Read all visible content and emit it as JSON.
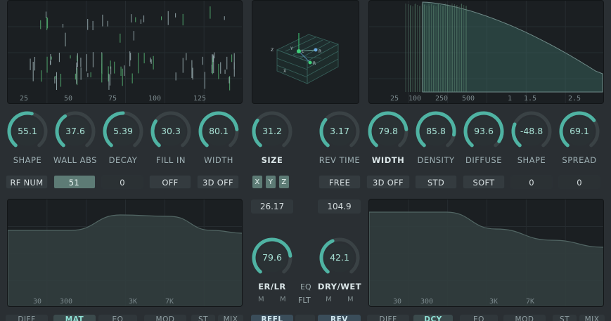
{
  "colors": {
    "accent": "#4fb3a3",
    "background": "#2a2f33",
    "panel": "#1b1f22",
    "value_text": "#a7e0d4"
  },
  "left_scope": {
    "ticks": [
      "25",
      "50",
      "75",
      "100",
      "125"
    ]
  },
  "room_view": {
    "axis_labels": [
      "Z",
      "Y",
      "L",
      "R",
      "X",
      "R"
    ]
  },
  "right_scope": {
    "ticks": [
      "25",
      "100",
      "250",
      "500",
      "1",
      "1.5",
      "2.5"
    ]
  },
  "left_knobs": [
    {
      "label": "SHAPE",
      "value": "55.1",
      "level": 0.55
    },
    {
      "label": "WALL ABS",
      "value": "37.6",
      "level": 0.38
    },
    {
      "label": "DECAY",
      "value": "5.39",
      "level": 0.5
    },
    {
      "label": "FILL IN",
      "value": "30.3",
      "level": 0.3
    },
    {
      "label": "WIDTH",
      "value": "80.1",
      "level": 0.8
    }
  ],
  "size_knob": {
    "label": "SIZE",
    "value": "31.2",
    "level": 0.31
  },
  "right_knobs": [
    {
      "label": "REV TIME",
      "value": "3.17",
      "level": 0.32
    },
    {
      "label": "WIDTH",
      "value": "79.8",
      "level": 0.8
    },
    {
      "label": "DENSITY",
      "value": "85.8",
      "level": 0.86
    },
    {
      "label": "DIFFUSE",
      "value": "93.6",
      "level": 0.94
    },
    {
      "label": "SHAPE",
      "value": "-48.8",
      "level": 0.26
    },
    {
      "label": "SPREAD",
      "value": "69.1",
      "level": 0.69
    }
  ],
  "left_buttons": [
    "RF NUM",
    "51",
    "0",
    "OFF",
    "3D OFF"
  ],
  "xyz_buttons": [
    "X",
    "Y",
    "Z"
  ],
  "right_buttons": [
    "FREE",
    "3D OFF",
    "STD",
    "SOFT",
    "0",
    "0"
  ],
  "center": {
    "size_value": "26.17",
    "time_value": "104.9",
    "er_lr_knob": {
      "label": "ER/LR",
      "value": "79.6",
      "level": 0.8
    },
    "dry_wet_knob": {
      "label": "DRY/WET",
      "value": "42.1",
      "level": 0.42
    },
    "eq_label": "EQ",
    "flt_label": "FLT",
    "m_labels": [
      "M",
      "M",
      "M",
      "M"
    ]
  },
  "left_eq": {
    "ticks": [
      "30",
      "300",
      "3K",
      "7K"
    ]
  },
  "right_eq": {
    "ticks": [
      "30",
      "300",
      "3K",
      "7K"
    ]
  },
  "left_tabs": [
    "DIFF",
    "MAT",
    "EQ",
    "MOD",
    "ST",
    "MIX"
  ],
  "center_tabs": [
    "REFL",
    "",
    "REV"
  ],
  "right_tabs": [
    "DIFF",
    "DCY",
    "EQ",
    "MOD",
    "ST",
    "MIX"
  ]
}
